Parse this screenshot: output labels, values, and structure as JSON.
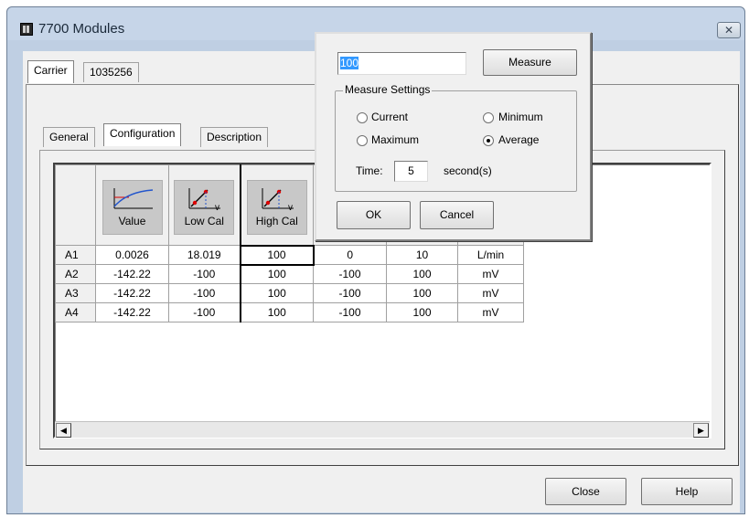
{
  "window": {
    "title": "7700 Modules",
    "close_glyph": "✕"
  },
  "outer_tabs": [
    "Carrier",
    "1035256"
  ],
  "inner_tabs": [
    "General",
    "Configuration",
    "Description"
  ],
  "grid": {
    "headers": [
      "Value",
      "Low Cal",
      "High Cal"
    ],
    "rows": [
      {
        "label": "A1",
        "cells": [
          "0.0026",
          "18.019",
          "100",
          "0",
          "10",
          "L/min"
        ]
      },
      {
        "label": "A2",
        "cells": [
          "-142.22",
          "-100",
          "100",
          "-100",
          "100",
          "mV"
        ]
      },
      {
        "label": "A3",
        "cells": [
          "-142.22",
          "-100",
          "100",
          "-100",
          "100",
          "mV"
        ]
      },
      {
        "label": "A4",
        "cells": [
          "-142.22",
          "-100",
          "100",
          "-100",
          "100",
          "mV"
        ]
      }
    ]
  },
  "footer": {
    "close": "Close",
    "help": "Help"
  },
  "dialog": {
    "value": "100",
    "measure_label": "Measure",
    "settings_title": "Measure Settings",
    "options": {
      "current": "Current",
      "minimum": "Minimum",
      "maximum": "Maximum",
      "average": "Average"
    },
    "selected_option": "Average",
    "time_label": "Time:",
    "time_value": "5",
    "time_unit": "second(s)",
    "ok_label": "OK",
    "cancel_label": "Cancel"
  },
  "scroll": {
    "left_glyph": "◀",
    "right_glyph": "▶"
  },
  "colors": {
    "title_bar": "#c6d5e8",
    "selection": "#3399ff"
  },
  "icons": [
    "app-icon",
    "close-icon",
    "value-graph-icon",
    "low-cal-graph-icon",
    "high-cal-graph-icon",
    "scroll-left-icon",
    "scroll-right-icon"
  ]
}
